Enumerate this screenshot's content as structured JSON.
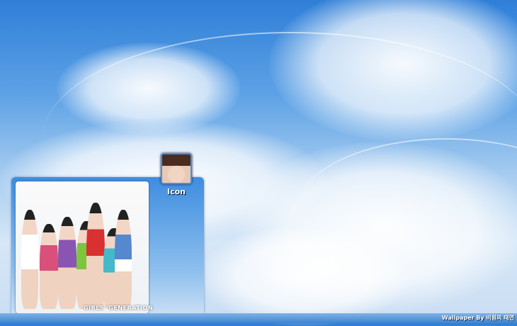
{
  "desktop": {
    "icons": [
      {
        "label": "Icon"
      }
    ],
    "photo_caption": "GIRLS' GENERATION",
    "credit": "Wallpaper By 비원의 태연"
  }
}
